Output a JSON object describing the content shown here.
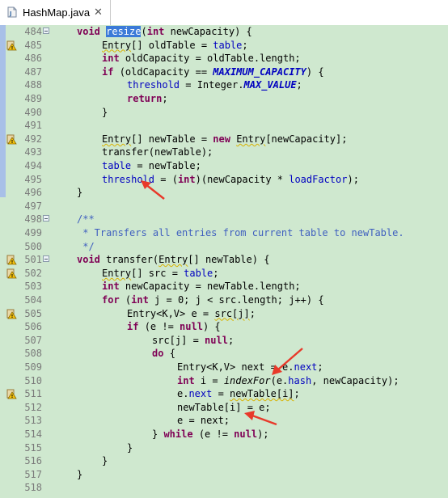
{
  "tab": {
    "title": "HashMap.java",
    "close": "✕"
  },
  "lines": [
    {
      "n": "484",
      "fold": true,
      "warn": false,
      "indent": 1,
      "tokens": [
        {
          "t": "void ",
          "c": "kw"
        },
        {
          "t": "resize",
          "c": "sel"
        },
        {
          "t": "(",
          "c": ""
        },
        {
          "t": "int ",
          "c": "kw"
        },
        {
          "t": "newCapacity) {",
          "c": ""
        }
      ]
    },
    {
      "n": "485",
      "fold": false,
      "warn": true,
      "indent": 2,
      "tokens": [
        {
          "t": "Entry",
          "c": "warnu"
        },
        {
          "t": "[] oldTable = ",
          "c": ""
        },
        {
          "t": "table",
          "c": "fld"
        },
        {
          "t": ";",
          "c": ""
        }
      ]
    },
    {
      "n": "486",
      "fold": false,
      "warn": false,
      "indent": 2,
      "tokens": [
        {
          "t": "int ",
          "c": "kw"
        },
        {
          "t": "oldCapacity = oldTable.length;",
          "c": ""
        }
      ]
    },
    {
      "n": "487",
      "fold": false,
      "warn": false,
      "indent": 2,
      "tokens": [
        {
          "t": "if ",
          "c": "kw"
        },
        {
          "t": "(oldCapacity == ",
          "c": ""
        },
        {
          "t": "MAXIMUM_CAPACITY",
          "c": "cst"
        },
        {
          "t": ") {",
          "c": ""
        }
      ]
    },
    {
      "n": "488",
      "fold": false,
      "warn": false,
      "indent": 3,
      "tokens": [
        {
          "t": "threshold",
          "c": "fld"
        },
        {
          "t": " = Integer.",
          "c": ""
        },
        {
          "t": "MAX_VALUE",
          "c": "cst"
        },
        {
          "t": ";",
          "c": ""
        }
      ]
    },
    {
      "n": "489",
      "fold": false,
      "warn": false,
      "indent": 3,
      "tokens": [
        {
          "t": "return",
          "c": "kw"
        },
        {
          "t": ";",
          "c": ""
        }
      ]
    },
    {
      "n": "490",
      "fold": false,
      "warn": false,
      "indent": 2,
      "tokens": [
        {
          "t": "}",
          "c": ""
        }
      ]
    },
    {
      "n": "491",
      "fold": false,
      "warn": false,
      "indent": 0,
      "tokens": []
    },
    {
      "n": "492",
      "fold": false,
      "warn": true,
      "indent": 2,
      "tokens": [
        {
          "t": "Entry",
          "c": "warnu"
        },
        {
          "t": "[] newTable = ",
          "c": ""
        },
        {
          "t": "new ",
          "c": "kw"
        },
        {
          "t": "Entry",
          "c": "warnu"
        },
        {
          "t": "[newCapacity];",
          "c": ""
        }
      ]
    },
    {
      "n": "493",
      "fold": false,
      "warn": false,
      "indent": 2,
      "tokens": [
        {
          "t": "transfer(newTable);",
          "c": ""
        }
      ]
    },
    {
      "n": "494",
      "fold": false,
      "warn": false,
      "indent": 2,
      "tokens": [
        {
          "t": "table",
          "c": "fld"
        },
        {
          "t": " = newTable;",
          "c": ""
        }
      ]
    },
    {
      "n": "495",
      "fold": false,
      "warn": false,
      "indent": 2,
      "tokens": [
        {
          "t": "threshold",
          "c": "fld"
        },
        {
          "t": " = (",
          "c": ""
        },
        {
          "t": "int",
          "c": "kw"
        },
        {
          "t": ")(newCapacity * ",
          "c": ""
        },
        {
          "t": "loadFactor",
          "c": "fld"
        },
        {
          "t": ");",
          "c": ""
        }
      ]
    },
    {
      "n": "496",
      "fold": false,
      "warn": false,
      "indent": 1,
      "tokens": [
        {
          "t": "}",
          "c": ""
        }
      ]
    },
    {
      "n": "497",
      "fold": false,
      "warn": false,
      "indent": 0,
      "tokens": []
    },
    {
      "n": "498",
      "fold": true,
      "warn": false,
      "indent": 1,
      "tokens": [
        {
          "t": "/**",
          "c": "cmt"
        }
      ]
    },
    {
      "n": "499",
      "fold": false,
      "warn": false,
      "indent": 1,
      "tokens": [
        {
          "t": " * Transfers all entries from current table to newTable.",
          "c": "cmt"
        }
      ]
    },
    {
      "n": "500",
      "fold": false,
      "warn": false,
      "indent": 1,
      "tokens": [
        {
          "t": " */",
          "c": "cmt"
        }
      ]
    },
    {
      "n": "501",
      "fold": true,
      "warn": true,
      "indent": 1,
      "tokens": [
        {
          "t": "void ",
          "c": "kw"
        },
        {
          "t": "transfer(",
          "c": ""
        },
        {
          "t": "Entry",
          "c": "warnu"
        },
        {
          "t": "[] newTable) {",
          "c": ""
        }
      ]
    },
    {
      "n": "502",
      "fold": false,
      "warn": true,
      "indent": 2,
      "tokens": [
        {
          "t": "Entry",
          "c": "warnu"
        },
        {
          "t": "[] src = ",
          "c": ""
        },
        {
          "t": "table",
          "c": "fld"
        },
        {
          "t": ";",
          "c": ""
        }
      ]
    },
    {
      "n": "503",
      "fold": false,
      "warn": false,
      "indent": 2,
      "tokens": [
        {
          "t": "int ",
          "c": "kw"
        },
        {
          "t": "newCapacity = newTable.length;",
          "c": ""
        }
      ]
    },
    {
      "n": "504",
      "fold": false,
      "warn": false,
      "indent": 2,
      "tokens": [
        {
          "t": "for ",
          "c": "kw"
        },
        {
          "t": "(",
          "c": ""
        },
        {
          "t": "int ",
          "c": "kw"
        },
        {
          "t": "j = 0; j < src.length; j++) {",
          "c": ""
        }
      ]
    },
    {
      "n": "505",
      "fold": false,
      "warn": true,
      "indent": 3,
      "tokens": [
        {
          "t": "Entry<K,V> e = ",
          "c": ""
        },
        {
          "t": "src[j]",
          "c": "warnu"
        },
        {
          "t": ";",
          "c": ""
        }
      ]
    },
    {
      "n": "506",
      "fold": false,
      "warn": false,
      "indent": 3,
      "tokens": [
        {
          "t": "if ",
          "c": "kw"
        },
        {
          "t": "(e != ",
          "c": ""
        },
        {
          "t": "null",
          "c": "kw"
        },
        {
          "t": ") {",
          "c": ""
        }
      ]
    },
    {
      "n": "507",
      "fold": false,
      "warn": false,
      "indent": 4,
      "tokens": [
        {
          "t": "src[j] = ",
          "c": ""
        },
        {
          "t": "null",
          "c": "kw"
        },
        {
          "t": ";",
          "c": ""
        }
      ]
    },
    {
      "n": "508",
      "fold": false,
      "warn": false,
      "indent": 4,
      "tokens": [
        {
          "t": "do ",
          "c": "kw"
        },
        {
          "t": "{",
          "c": ""
        }
      ]
    },
    {
      "n": "509",
      "fold": false,
      "warn": false,
      "indent": 5,
      "tokens": [
        {
          "t": "Entry<K,V> next = e.",
          "c": ""
        },
        {
          "t": "next",
          "c": "fld"
        },
        {
          "t": ";",
          "c": ""
        }
      ]
    },
    {
      "n": "510",
      "fold": false,
      "warn": false,
      "indent": 5,
      "tokens": [
        {
          "t": "int ",
          "c": "kw"
        },
        {
          "t": "i = ",
          "c": ""
        },
        {
          "t": "indexFor",
          "c": "itl"
        },
        {
          "t": "(e.",
          "c": ""
        },
        {
          "t": "hash",
          "c": "fld"
        },
        {
          "t": ", newCapacity);",
          "c": ""
        }
      ]
    },
    {
      "n": "511",
      "fold": false,
      "warn": true,
      "indent": 5,
      "tokens": [
        {
          "t": "e.",
          "c": ""
        },
        {
          "t": "next",
          "c": "fld"
        },
        {
          "t": " = ",
          "c": ""
        },
        {
          "t": "newTable[i]",
          "c": "warnu"
        },
        {
          "t": ";",
          "c": ""
        }
      ]
    },
    {
      "n": "512",
      "fold": false,
      "warn": false,
      "indent": 5,
      "tokens": [
        {
          "t": "newTable[i] = e;",
          "c": ""
        }
      ]
    },
    {
      "n": "513",
      "fold": false,
      "warn": false,
      "indent": 5,
      "tokens": [
        {
          "t": "e = next;",
          "c": ""
        }
      ]
    },
    {
      "n": "514",
      "fold": false,
      "warn": false,
      "indent": 4,
      "tokens": [
        {
          "t": "} ",
          "c": ""
        },
        {
          "t": "while ",
          "c": "kw"
        },
        {
          "t": "(e != ",
          "c": ""
        },
        {
          "t": "null",
          "c": "kw"
        },
        {
          "t": ");",
          "c": ""
        }
      ]
    },
    {
      "n": "515",
      "fold": false,
      "warn": false,
      "indent": 3,
      "tokens": [
        {
          "t": "}",
          "c": ""
        }
      ]
    },
    {
      "n": "516",
      "fold": false,
      "warn": false,
      "indent": 2,
      "tokens": [
        {
          "t": "}",
          "c": ""
        }
      ]
    },
    {
      "n": "517",
      "fold": false,
      "warn": false,
      "indent": 1,
      "tokens": [
        {
          "t": "}",
          "c": ""
        }
      ]
    },
    {
      "n": "518",
      "fold": false,
      "warn": false,
      "indent": 0,
      "tokens": []
    }
  ],
  "icons": {
    "file": "java-file-icon",
    "warning": "warning-icon",
    "fold": "fold-toggle-icon",
    "annotation": "red-arrow-annotation"
  },
  "colors": {
    "editor_bg": "#cfe8cf",
    "keyword": "#7f0055",
    "field": "#0000c0",
    "comment": "#3f5fbf",
    "selection": "#3b7ad8",
    "annotation": "#e8392a"
  }
}
